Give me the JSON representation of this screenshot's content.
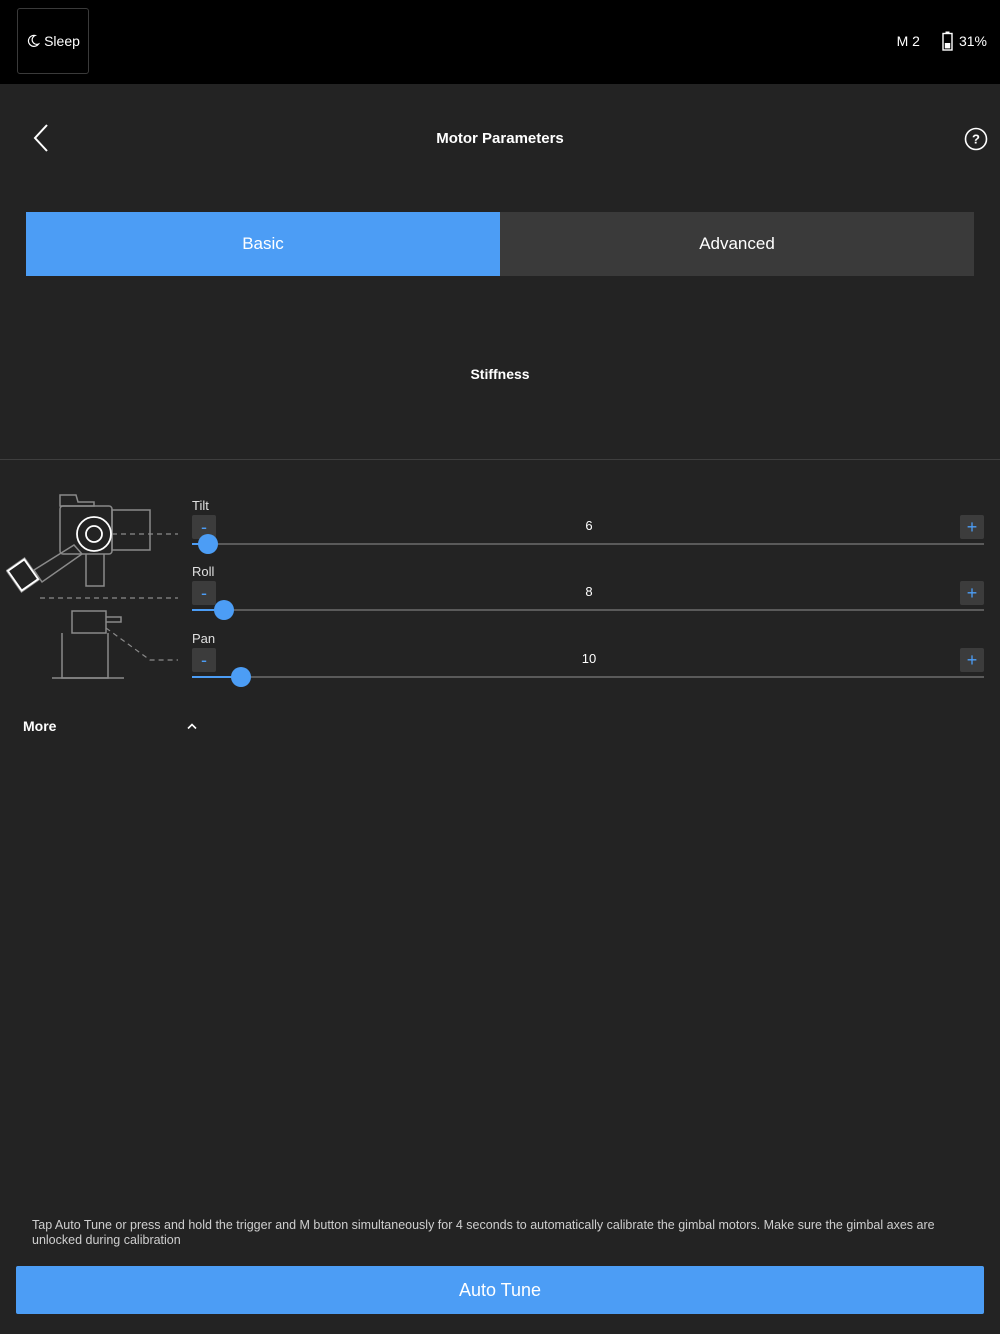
{
  "status_bar": {
    "sleep_label": "Sleep",
    "mode_label": "M 2",
    "battery_percent": "31%"
  },
  "header": {
    "title": "Motor Parameters"
  },
  "tabs": [
    {
      "label": "Basic",
      "active": true
    },
    {
      "label": "Advanced",
      "active": false
    }
  ],
  "section": {
    "title": "Stiffness"
  },
  "sliders": [
    {
      "label": "Tilt",
      "value": "6",
      "fraction": 0.02,
      "minus": "-",
      "plus": "+"
    },
    {
      "label": "Roll",
      "value": "8",
      "fraction": 0.04,
      "minus": "-",
      "plus": "+"
    },
    {
      "label": "Pan",
      "value": "10",
      "fraction": 0.062,
      "minus": "-",
      "plus": "+"
    }
  ],
  "more": {
    "label": "More"
  },
  "footer": {
    "hint": "Tap Auto Tune or press and hold the trigger and M button simultaneously for 4 seconds to automatically calibrate the gimbal motors. Make sure the gimbal axes are unlocked during calibration",
    "auto_tune_label": "Auto Tune"
  },
  "colors": {
    "accent": "#4c9df5",
    "background": "#232323",
    "status_bar": "#000000",
    "tab_inactive": "#3a3a3a"
  },
  "icons": {
    "sleep": "moon-icon",
    "battery": "battery-icon",
    "back": "chevron-left-icon",
    "help": "help-circle-icon",
    "more": "chevron-up-icon"
  }
}
